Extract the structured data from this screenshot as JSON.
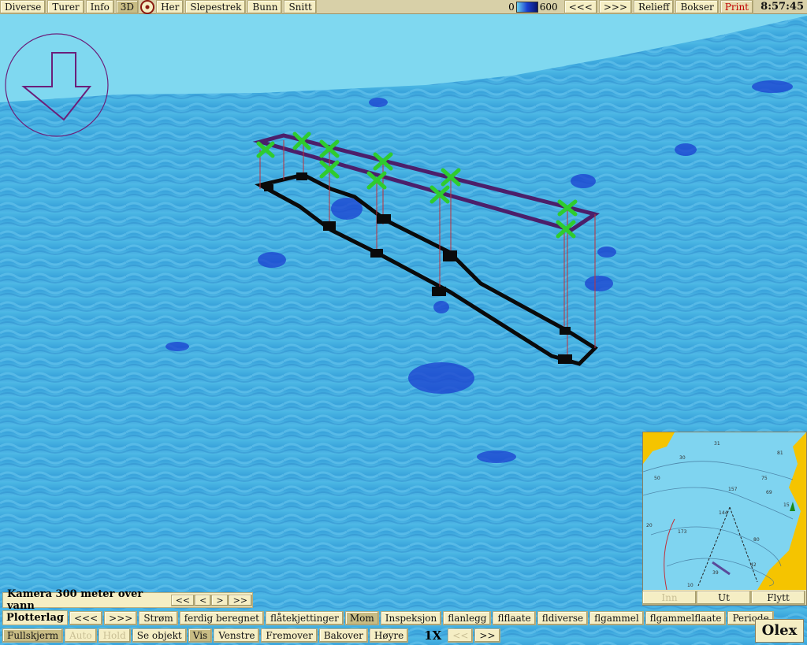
{
  "topbar": {
    "left_buttons": [
      "Diverse",
      "Turer",
      "Info",
      "3D",
      "Her",
      "Slepestrek",
      "Bunn",
      "Snitt"
    ],
    "scale_min": "0",
    "scale_max": "600",
    "right_buttons": [
      "<<<",
      ">>>",
      "Relieff",
      "Bokser",
      "Print"
    ],
    "clock": "8:57:45"
  },
  "camera": {
    "label": "Kamera 300 meter over vann",
    "nav": [
      "<<",
      "<",
      ">",
      ">>"
    ]
  },
  "plotterlag": {
    "label": "Plotterlag",
    "buttons": [
      "<<<",
      ">>>",
      "Strøm",
      "ferdig beregnet",
      "flåtekjettinger",
      "Mom",
      "Inspeksjon",
      "flanlegg",
      "flflaate",
      "fldiverse",
      "flgammel",
      "flgammelflaate",
      "Periode"
    ]
  },
  "bottombar": {
    "buttons": [
      "Fullskjerm",
      "Auto",
      "Hold",
      "Se objekt",
      "Vis",
      "Venstre",
      "Fremover",
      "Bakover",
      "Høyre"
    ],
    "speed": "1X",
    "speed_nav": [
      "<<",
      ">>"
    ]
  },
  "minimap": {
    "depth_labels": [
      "31",
      "81",
      "30",
      "50",
      "157",
      "69",
      "75",
      "15",
      "144",
      "173",
      "80",
      "42",
      "39",
      "10",
      "20"
    ],
    "buttons": [
      "Inn",
      "Ut",
      "Flytt"
    ]
  },
  "brand": "Olex",
  "colors": {
    "water": "#7fd8f0",
    "seabed": "#3fa8dc",
    "deep": "#1a3fd0",
    "marker": "#2ecc2e",
    "frame": "#4b1f6a"
  }
}
